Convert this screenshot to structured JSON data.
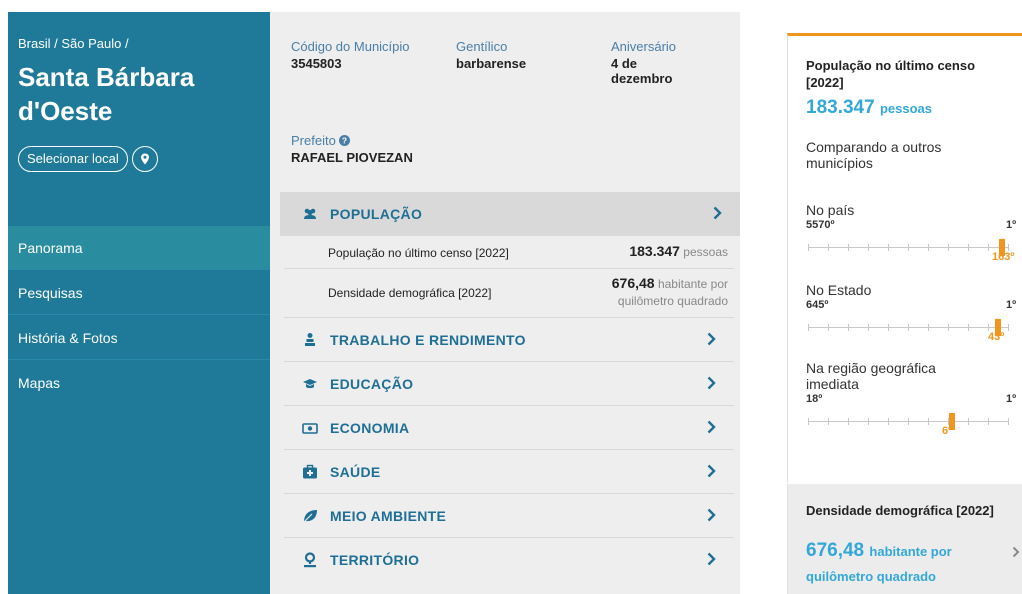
{
  "sidebar": {
    "breadcrumb": "Brasil / São Paulo /",
    "place_name": "Santa Bárbara d'Oeste",
    "select_label": "Selecionar local",
    "nav": [
      {
        "label": "Panorama"
      },
      {
        "label": "Pesquisas"
      },
      {
        "label": "História & Fotos"
      },
      {
        "label": "Mapas"
      }
    ],
    "colors": {
      "bg": "#1f7a99",
      "active": "#2a8d9f"
    }
  },
  "info": {
    "codigo_label": "Código do Município",
    "codigo_value": "3545803",
    "gentilico_label": "Gentílico",
    "gentilico_value": "barbarense",
    "aniversario_label": "Aniversário",
    "aniversario_value": "4 de dezembro",
    "prefeito_label": "Prefeito",
    "prefeito_value": "RAFAEL PIOVEZAN"
  },
  "sections": [
    {
      "label": "POPULAÇÃO",
      "icon": "people-icon"
    },
    {
      "label": "TRABALHO E RENDIMENTO",
      "icon": "worker-icon"
    },
    {
      "label": "EDUCAÇÃO",
      "icon": "graduation-cap-icon"
    },
    {
      "label": "ECONOMIA",
      "icon": "money-icon"
    },
    {
      "label": "SAÚDE",
      "icon": "medical-kit-icon"
    },
    {
      "label": "MEIO AMBIENTE",
      "icon": "leaf-icon"
    },
    {
      "label": "TERRITÓRIO",
      "icon": "map-pin-icon"
    }
  ],
  "populacao": {
    "rows": [
      {
        "label": "População no último censo [2022]",
        "value": "183.347",
        "unit": "pessoas"
      },
      {
        "label": "Densidade demográfica [2022]",
        "value": "676,48",
        "unit_line1": "habitante por",
        "unit_line2": "quilômetro quadrado"
      }
    ]
  },
  "right": {
    "card1": {
      "title": "População no último censo [2022]",
      "value": "183.347",
      "unit": "pessoas",
      "compare_text": "Comparando a outros municípios",
      "rankings": [
        {
          "label": "No país",
          "low": "5570º",
          "high": "1º",
          "position": "163º",
          "fraction": 0.97
        },
        {
          "label": "No Estado",
          "low": "645º",
          "high": "1º",
          "position": "43º",
          "fraction": 0.95
        },
        {
          "label": "Na região geográfica imediata",
          "low": "18º",
          "high": "1º",
          "position": "6º",
          "fraction": 0.72
        }
      ]
    },
    "card2": {
      "title": "Densidade demográfica [2022]",
      "value": "676,48",
      "unit_line1": "habitante por",
      "unit_line2": "quilômetro quadrado"
    },
    "colors": {
      "accent": "#f0961e",
      "value": "#33a8d8"
    }
  }
}
